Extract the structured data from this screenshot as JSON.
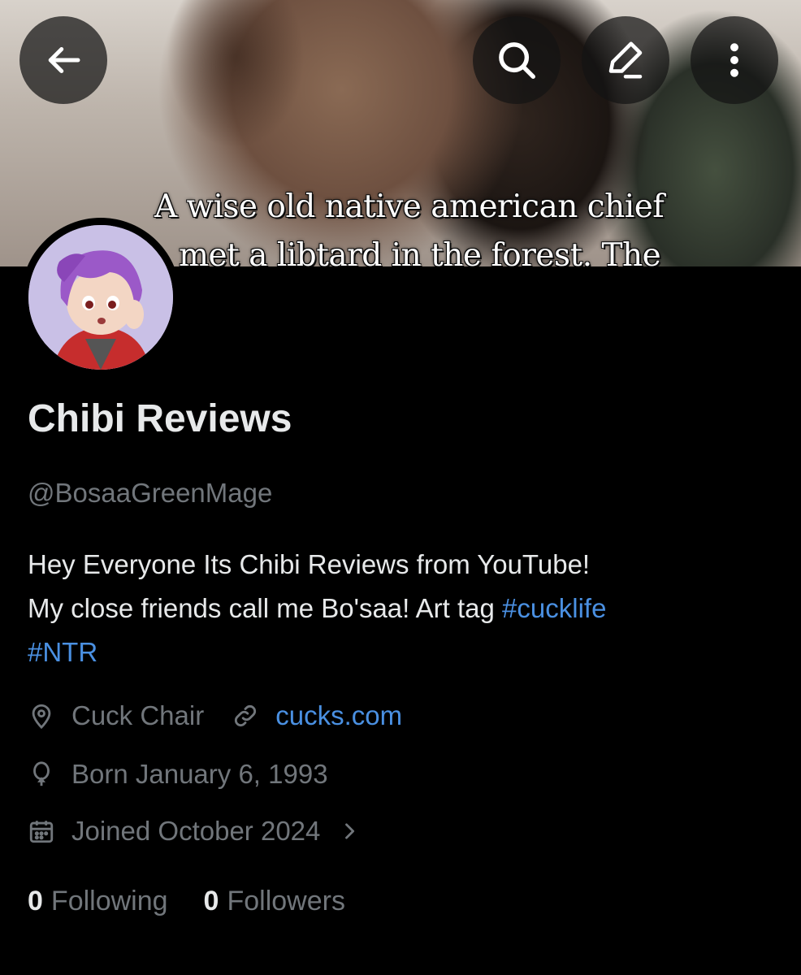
{
  "banner": {
    "caption_line_1": "A wise old native american chief",
    "caption_line_2": "met a libtard in the forest. The"
  },
  "header_buttons": {
    "back": "back-arrow-icon",
    "search": "search-icon",
    "edit": "edit-icon",
    "more": "more-vertical-icon"
  },
  "profile": {
    "display_name": "Chibi Reviews",
    "handle": "@BosaaGreenMage",
    "bio_line_1": "Hey Everyone Its Chibi Reviews from YouTube!",
    "bio_line_2_text": "My close friends call me Bo'saa! Art tag ",
    "bio_tag_1": "#cucklife",
    "bio_tag_2": "#NTR",
    "location": "Cuck Chair",
    "website": "cucks.com",
    "birthday": "Born January 6, 1993",
    "joined": "Joined October 2024"
  },
  "stats": {
    "following_count": "0",
    "following_label": "Following",
    "followers_count": "0",
    "followers_label": "Followers"
  },
  "colors": {
    "background": "#000000",
    "text": "#e7e9ea",
    "muted": "#71767b",
    "link": "#4a90e2"
  }
}
